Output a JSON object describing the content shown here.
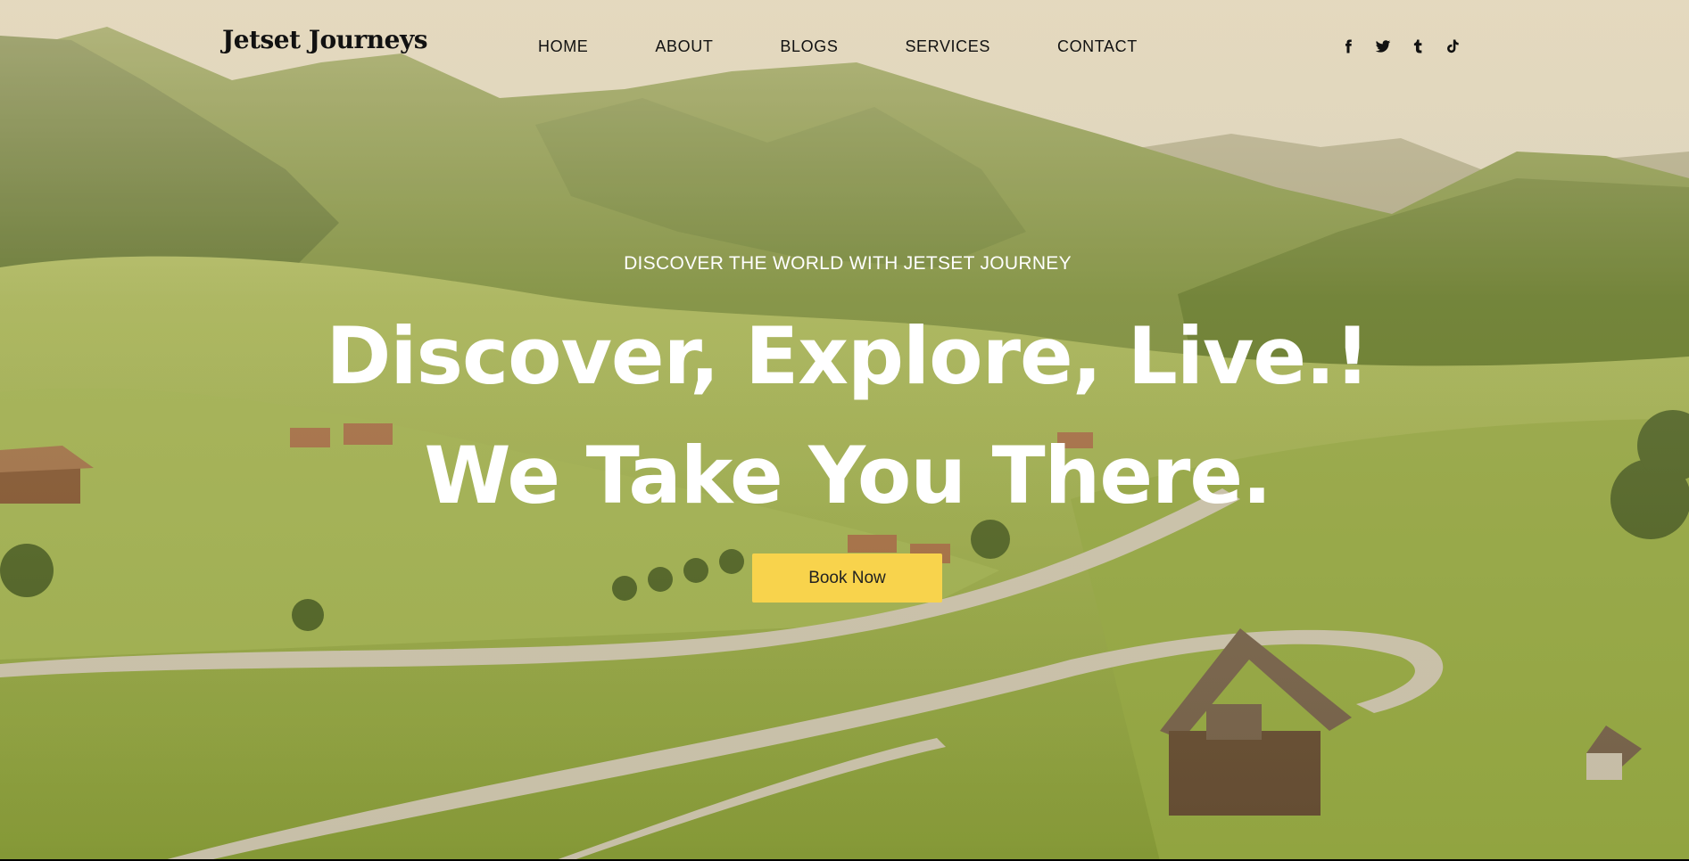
{
  "brand": {
    "name": "Jetset Journeys"
  },
  "nav": {
    "items": [
      {
        "label": "HOME"
      },
      {
        "label": "ABOUT"
      },
      {
        "label": "BLOGS"
      },
      {
        "label": "SERVICES"
      },
      {
        "label": "CONTACT"
      }
    ]
  },
  "socials": [
    {
      "icon": "facebook-icon"
    },
    {
      "icon": "twitter-icon"
    },
    {
      "icon": "tumblr-icon"
    },
    {
      "icon": "tiktok-icon"
    }
  ],
  "hero": {
    "tagline": "DISCOVER THE WORLD WITH JETSET JOURNEY",
    "headline_line1": "Discover, Explore, Live.!",
    "headline_line2": "We Take You There.",
    "cta_label": "Book Now"
  },
  "colors": {
    "cta": "#f8d34c",
    "heading_text": "#ffffff",
    "nav_text": "#111111"
  }
}
